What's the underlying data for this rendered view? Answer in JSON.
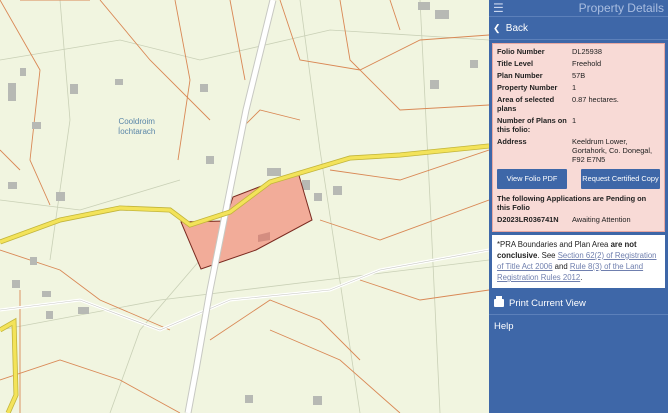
{
  "header": {
    "title": "Property Details",
    "menu_icon": "hamburger-icon"
  },
  "nav": {
    "back_label": "Back"
  },
  "map": {
    "place_name": "Cooldroim\nÍochtarach"
  },
  "details": {
    "rows": [
      {
        "key": "Folio Number",
        "value": "DL25938"
      },
      {
        "key": "Title Level",
        "value": "Freehold"
      },
      {
        "key": "Plan Number",
        "value": "57B"
      },
      {
        "key": "Property Number",
        "value": "1"
      },
      {
        "key": "Area of selected plans",
        "value": "0.87 hectares."
      },
      {
        "key": "Number of Plans on this folio:",
        "value": "1"
      },
      {
        "key": "Address",
        "value": "Keeldrum Lower, Gortahork, Co. Donegal, F92 E7N5"
      }
    ],
    "view_pdf_label": "View Folio PDF",
    "request_copy_label": "Request Certified Copy",
    "pending_heading": "The following Applications are Pending on this Folio",
    "pending": {
      "id": "D2023LR036741N",
      "status": "Awaiting Attention"
    }
  },
  "note": {
    "prefix": "*PRA Boundaries and Plan Area",
    "bold": "are not conclusive",
    "see": ". See",
    "link1": "Section 62(2) of Registration of Title Act 2006",
    "and": "and",
    "link2": "Rule 8(3) of the Land Registration Rules 2012",
    "end": "."
  },
  "menu": {
    "print_label": "Print Current View",
    "help_label": "Help"
  },
  "colors": {
    "panel": "#3e67a8",
    "parcel": "#f1a895",
    "road": "#f3e35a"
  }
}
